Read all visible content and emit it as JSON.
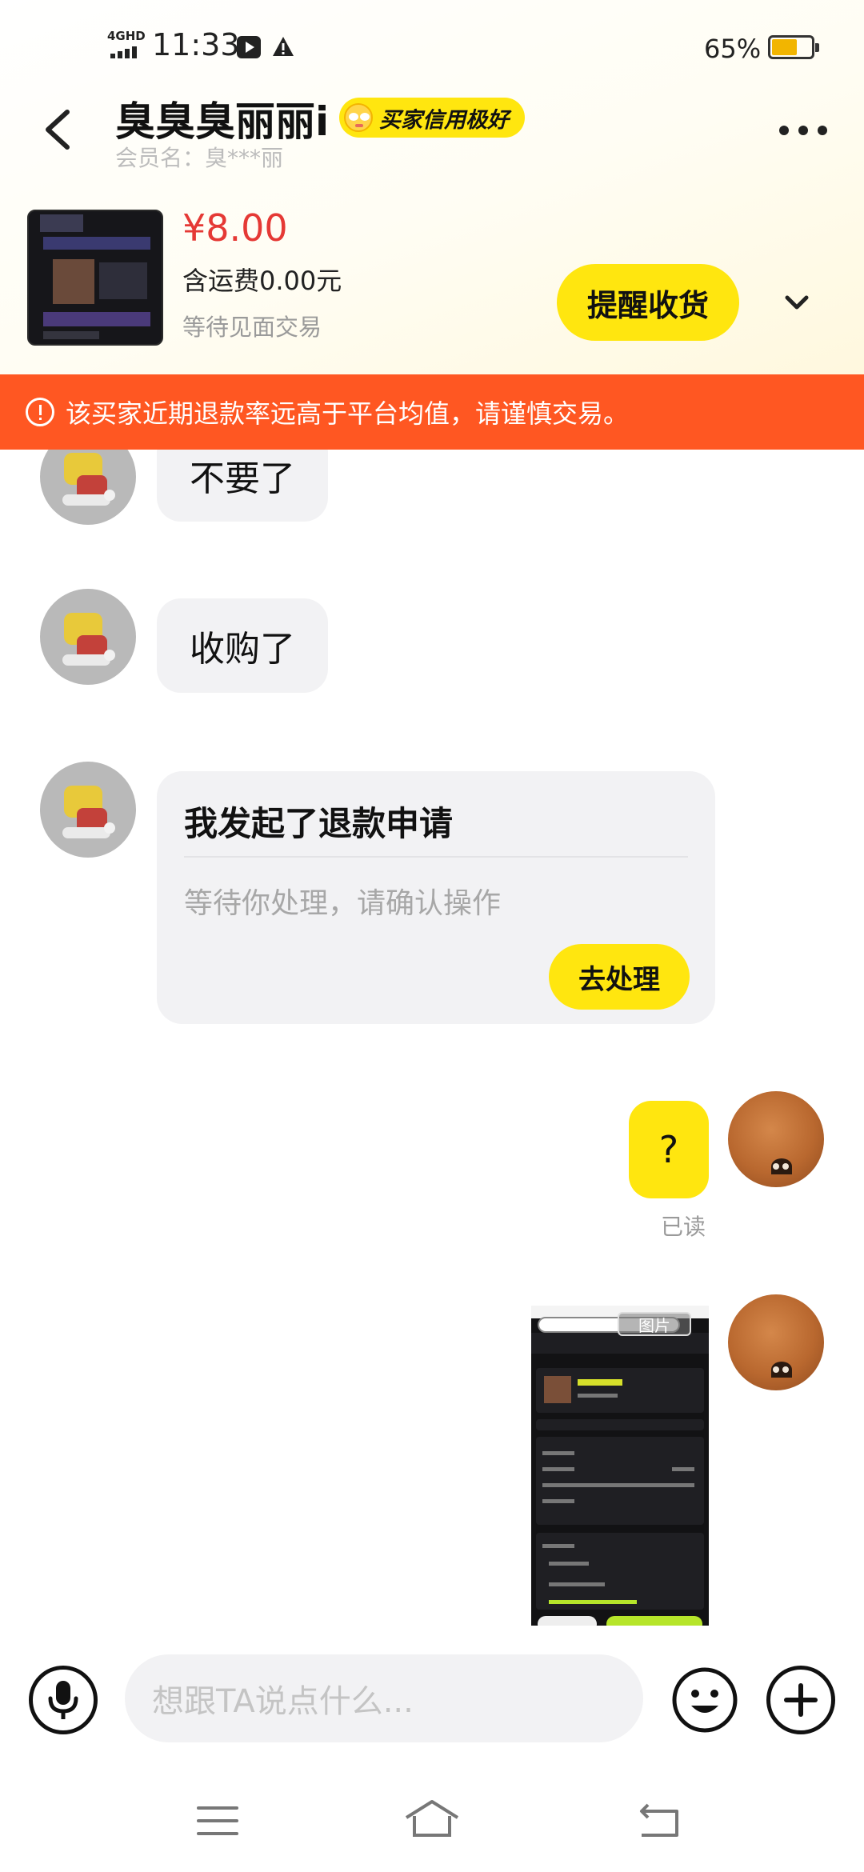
{
  "status_bar": {
    "network": "4GHD",
    "time": "11:33",
    "battery_percent": "65%",
    "battery_level": 0.65
  },
  "header": {
    "title": "臭臭臭丽丽i",
    "badge": "买家信用极好",
    "member_name": "会员名：臭***丽"
  },
  "order": {
    "price": "¥8.00",
    "shipping": "含运费0.00元",
    "status": "等待见面交易",
    "remind_button": "提醒收货"
  },
  "warning": {
    "text": "该买家近期退款率远高于平台均值，请谨慎交易。"
  },
  "messages": {
    "buyer_msg_1": "不要了",
    "buyer_msg_2": "收购了",
    "refund_card": {
      "title": "我发起了退款申请",
      "desc": "等待你处理，请确认操作",
      "button": "去处理"
    },
    "my_msg": "?",
    "read_status": "已读",
    "image_tag": "图片"
  },
  "input": {
    "placeholder": "想跟TA说点什么..."
  },
  "colors": {
    "accent_yellow": "#ffe60f",
    "warning_orange": "#ff5722",
    "price_red": "#e53935"
  }
}
